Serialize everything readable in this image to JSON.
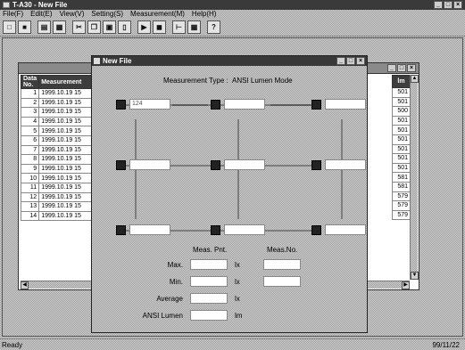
{
  "app": {
    "title": "T-A30 - New File"
  },
  "window_buttons": [
    "_",
    "□",
    "×"
  ],
  "menu": [
    "File(F)",
    "Edit(E)",
    "View(V)",
    "Setting(S)",
    "Measurement(M)",
    "Help(H)"
  ],
  "toolbar": {
    "buttons": [
      {
        "name": "new-icon",
        "glyph": "□"
      },
      {
        "name": "save-icon",
        "glyph": "■"
      },
      {
        "name": "print-preview-icon",
        "glyph": "▤"
      },
      {
        "name": "print-icon",
        "glyph": "▦"
      },
      {
        "name": "cut-icon",
        "glyph": "✂"
      },
      {
        "name": "copy-icon",
        "glyph": "❐"
      },
      {
        "name": "paste-icon",
        "glyph": "▣"
      },
      {
        "name": "zoom-icon",
        "glyph": "▯"
      },
      {
        "name": "measure-start-icon",
        "glyph": "▶"
      },
      {
        "name": "stop-icon",
        "glyph": "◼"
      },
      {
        "name": "graph-icon",
        "glyph": "⊢"
      },
      {
        "name": "table-icon",
        "glyph": "▦"
      },
      {
        "name": "help-icon",
        "glyph": "?"
      }
    ]
  },
  "table": {
    "headers": [
      "Data No.",
      "Measurement"
    ],
    "rows": [
      {
        "no": "1",
        "dt": "1999.10.19 15"
      },
      {
        "no": "2",
        "dt": "1999.10.19 15"
      },
      {
        "no": "3",
        "dt": "1999.10.19 15"
      },
      {
        "no": "4",
        "dt": "1999.10.19 15"
      },
      {
        "no": "5",
        "dt": "1999.10.19 15"
      },
      {
        "no": "6",
        "dt": "1999.10.19 15"
      },
      {
        "no": "7",
        "dt": "1999.10.19 15"
      },
      {
        "no": "8",
        "dt": "1999.10.19 15"
      },
      {
        "no": "9",
        "dt": "1999.10.19 15"
      },
      {
        "no": "10",
        "dt": "1999.10.19 15"
      },
      {
        "no": "11",
        "dt": "1999.10.19 15"
      },
      {
        "no": "12",
        "dt": "1999.10.19 15"
      },
      {
        "no": "13",
        "dt": "1999.10.19 15"
      },
      {
        "no": "14",
        "dt": "1999.10.19 15"
      }
    ],
    "right_header": "lm",
    "right_values": [
      "501",
      "501",
      "500",
      "501",
      "501",
      "501",
      "501",
      "501",
      "501",
      "581",
      "581",
      "579",
      "579",
      "579"
    ]
  },
  "dialog": {
    "title": "New File",
    "measurement_type_label": "Measurement Type :",
    "measurement_type_value": "ANSI Lumen Mode",
    "node_values": [
      "124",
      "",
      "",
      "",
      "",
      "",
      "",
      "",
      ""
    ],
    "stats": {
      "col_header_left": "Meas. Pnt.",
      "col_header_right": "Meas.No.",
      "rows": [
        {
          "label": "Max.",
          "unit": "lx"
        },
        {
          "label": "Min.",
          "unit": "lx"
        },
        {
          "label": "Average",
          "unit": "lx"
        },
        {
          "label": "ANSI Lumen",
          "unit": "lm"
        }
      ]
    }
  },
  "status": {
    "left": "Ready",
    "right": "99/11/22"
  }
}
